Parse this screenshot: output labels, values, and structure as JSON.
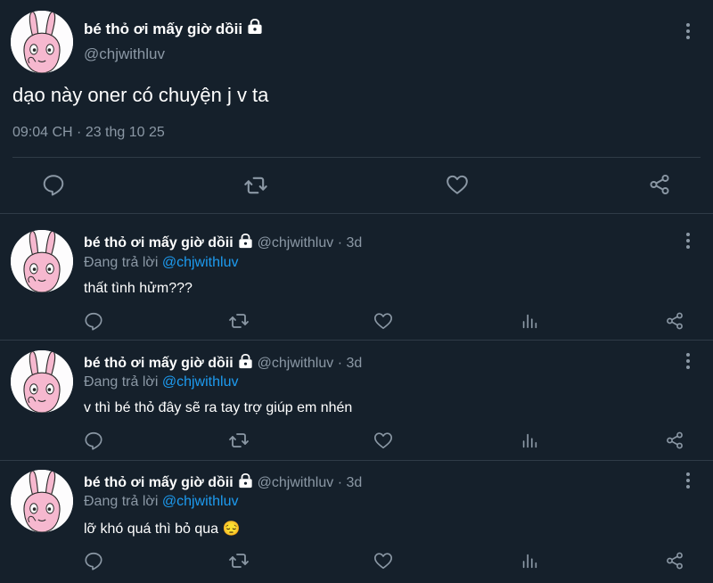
{
  "main_tweet": {
    "display_name": "bé thỏ ơi mấy giờ dồii",
    "handle": "@chjwithluv",
    "text": "dạo này oner có chuyện j v ta",
    "timestamp": "09:04 CH · 23 thg 10 25"
  },
  "replies": [
    {
      "display_name": "bé thỏ ơi mấy giờ dồii",
      "handle_time": "@chjwithluv · 3d",
      "replying_prefix": "Đang trả lời ",
      "replying_to": "@chjwithluv",
      "text": "thất tình hửm???"
    },
    {
      "display_name": "bé thỏ ơi mấy giờ dồii",
      "handle_time": "@chjwithluv · 3d",
      "replying_prefix": "Đang trả lời ",
      "replying_to": "@chjwithluv",
      "text": "v thì bé thỏ đây sẽ ra tay trợ giúp em nhén"
    },
    {
      "display_name": "bé thỏ ơi mấy giờ dồii",
      "handle_time": "@chjwithluv · 3d",
      "replying_prefix": "Đang trả lời ",
      "replying_to": "@chjwithluv",
      "text": "lỡ khó quá thì bỏ qua 😔"
    }
  ],
  "icons": {
    "reply": "speech-bubble-icon",
    "retweet": "retweet-icon",
    "like": "heart-icon",
    "views": "bar-chart-icon",
    "share": "share-icon",
    "more": "more-vertical-icon",
    "lock": "lock-icon"
  },
  "colors": {
    "background": "#15202b",
    "text": "#ffffff",
    "muted": "#8b98a5",
    "link": "#1d9bf0",
    "divider": "#2f3b47"
  }
}
